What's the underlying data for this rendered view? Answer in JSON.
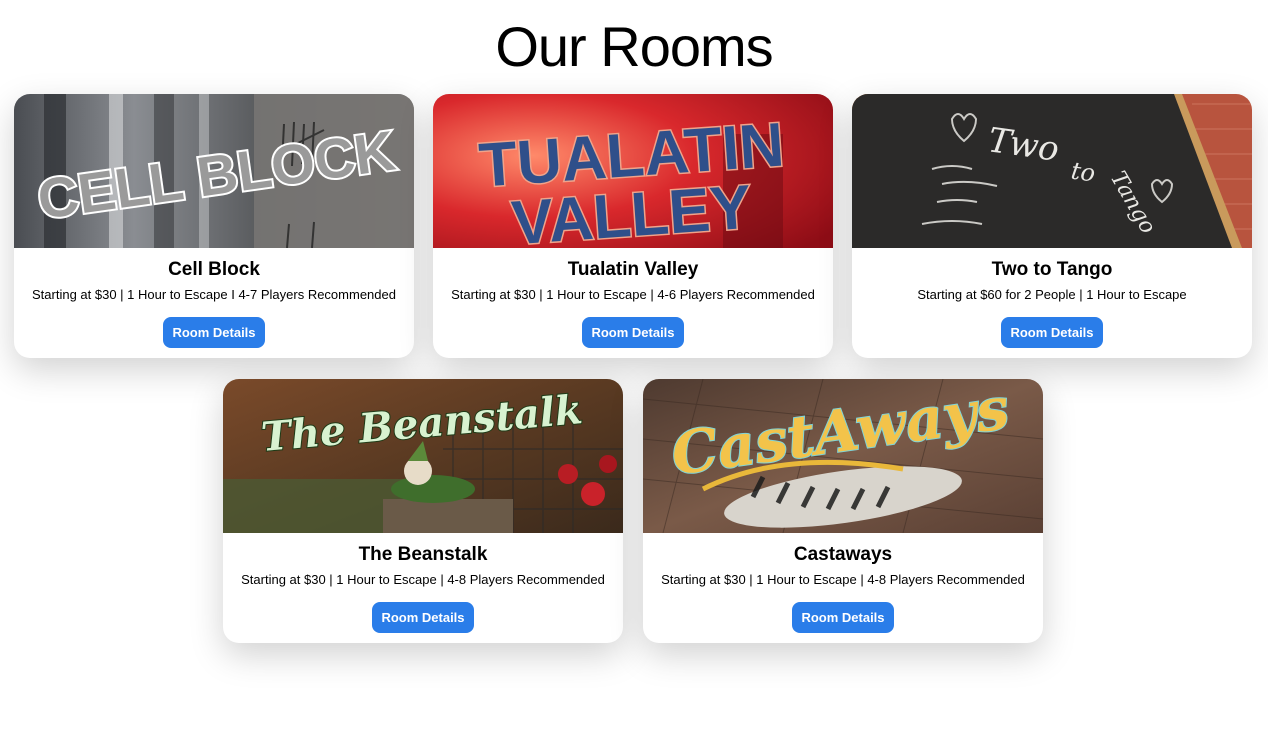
{
  "page": {
    "title": "Our Rooms"
  },
  "rooms": [
    {
      "image_text": "CELL BLOCK",
      "name": "Cell Block",
      "description": "Starting at $30 | 1 Hour to Escape I 4-7 Players Recommended",
      "button_label": "Room Details"
    },
    {
      "image_text_line1": "TUALATIN",
      "image_text_line2": "VALLEY",
      "name": "Tualatin Valley",
      "description": "Starting at $30 | 1 Hour to Escape | 4-6 Players Recommended",
      "button_label": "Room Details"
    },
    {
      "image_text_line1": "Two",
      "image_text_line2": "to",
      "image_text_line3": "Tango",
      "name": "Two to Tango",
      "description": "Starting at $60 for 2 People | 1 Hour to Escape",
      "button_label": "Room Details"
    },
    {
      "image_text": "The Beanstalk",
      "name": "The Beanstalk",
      "description": "Starting at $30 | 1 Hour to Escape | 4-8 Players Recommended",
      "button_label": "Room Details"
    },
    {
      "image_text": "CastAways",
      "name": "Castaways",
      "description": "Starting at $30 | 1 Hour to Escape | 4-8 Players Recommended",
      "button_label": "Room Details"
    }
  ],
  "colors": {
    "button": "#2a7de9",
    "card_shadow": "rgba(0,0,0,0.18)"
  }
}
